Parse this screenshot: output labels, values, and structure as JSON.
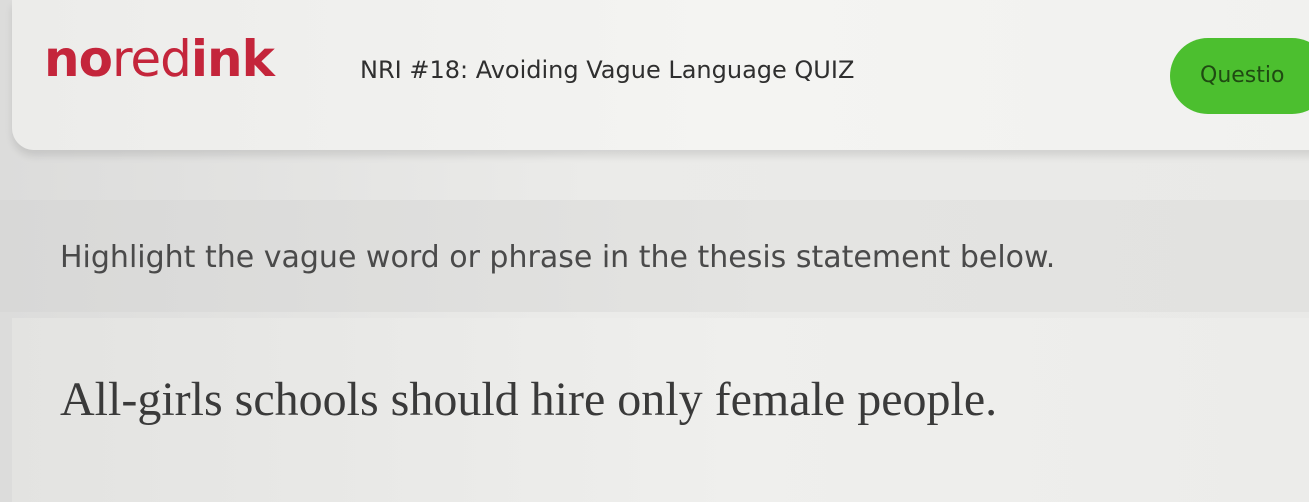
{
  "header": {
    "logo": {
      "part1": "no",
      "part2": "red",
      "part3": "ink"
    },
    "quiz_title": "NRI #18: Avoiding Vague Language QUIZ",
    "question_button": "Questio"
  },
  "instruction": "Highlight the vague word or phrase in the thesis statement below.",
  "sentence": {
    "words": [
      "All-girls",
      "schools",
      "should",
      "hire",
      "only",
      "female",
      "people."
    ]
  },
  "colors": {
    "brand_red": "#c4253b",
    "accent_green": "#4cbf2f"
  }
}
